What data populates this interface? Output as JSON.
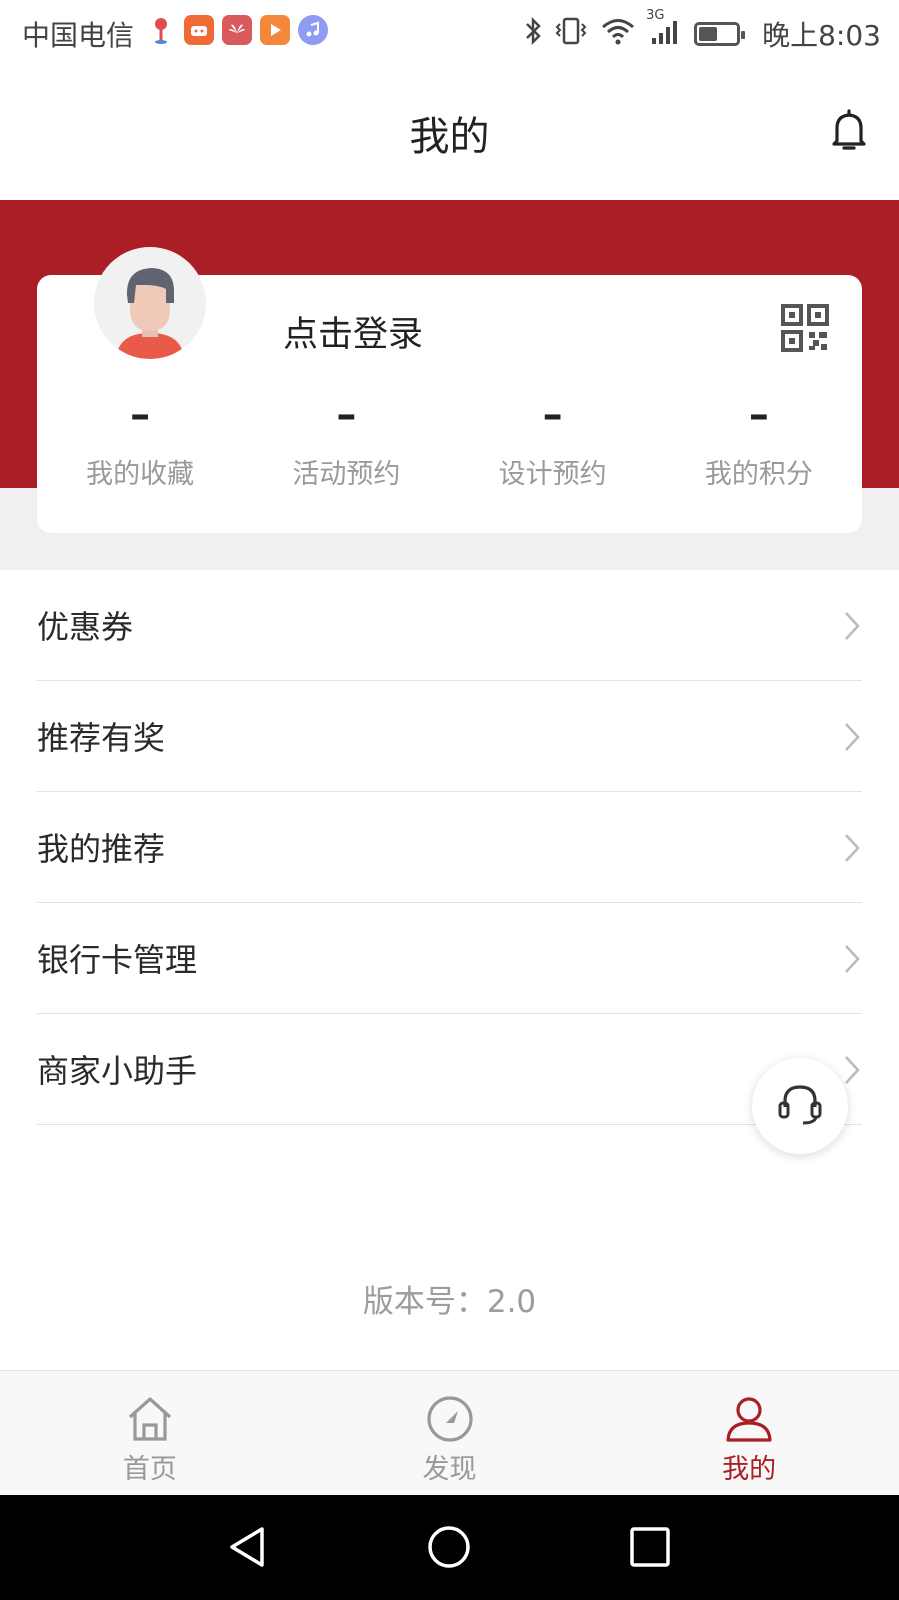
{
  "status_bar": {
    "carrier": "中国电信",
    "time": "晚上8:03",
    "network": "3G",
    "app_icons": [
      "location-pin-icon",
      "taobao-icon",
      "huawei-icon",
      "video-icon",
      "music-icon"
    ]
  },
  "header": {
    "title": "我的"
  },
  "profile": {
    "login_text": "点击登录",
    "stats": [
      {
        "value": "–",
        "label": "我的收藏"
      },
      {
        "value": "–",
        "label": "活动预约"
      },
      {
        "value": "–",
        "label": "设计预约"
      },
      {
        "value": "–",
        "label": "我的积分"
      }
    ]
  },
  "menu": [
    {
      "label": "优惠券"
    },
    {
      "label": "推荐有奖"
    },
    {
      "label": "我的推荐"
    },
    {
      "label": "银行卡管理"
    },
    {
      "label": "商家小助手"
    }
  ],
  "version_text": "版本号：2.0",
  "tabs": [
    {
      "label": "首页",
      "icon": "home-icon",
      "active": false
    },
    {
      "label": "发现",
      "icon": "compass-icon",
      "active": false
    },
    {
      "label": "我的",
      "icon": "user-icon",
      "active": true
    }
  ],
  "colors": {
    "brand_red": "#ab1e26",
    "inactive_gray": "#999999"
  }
}
